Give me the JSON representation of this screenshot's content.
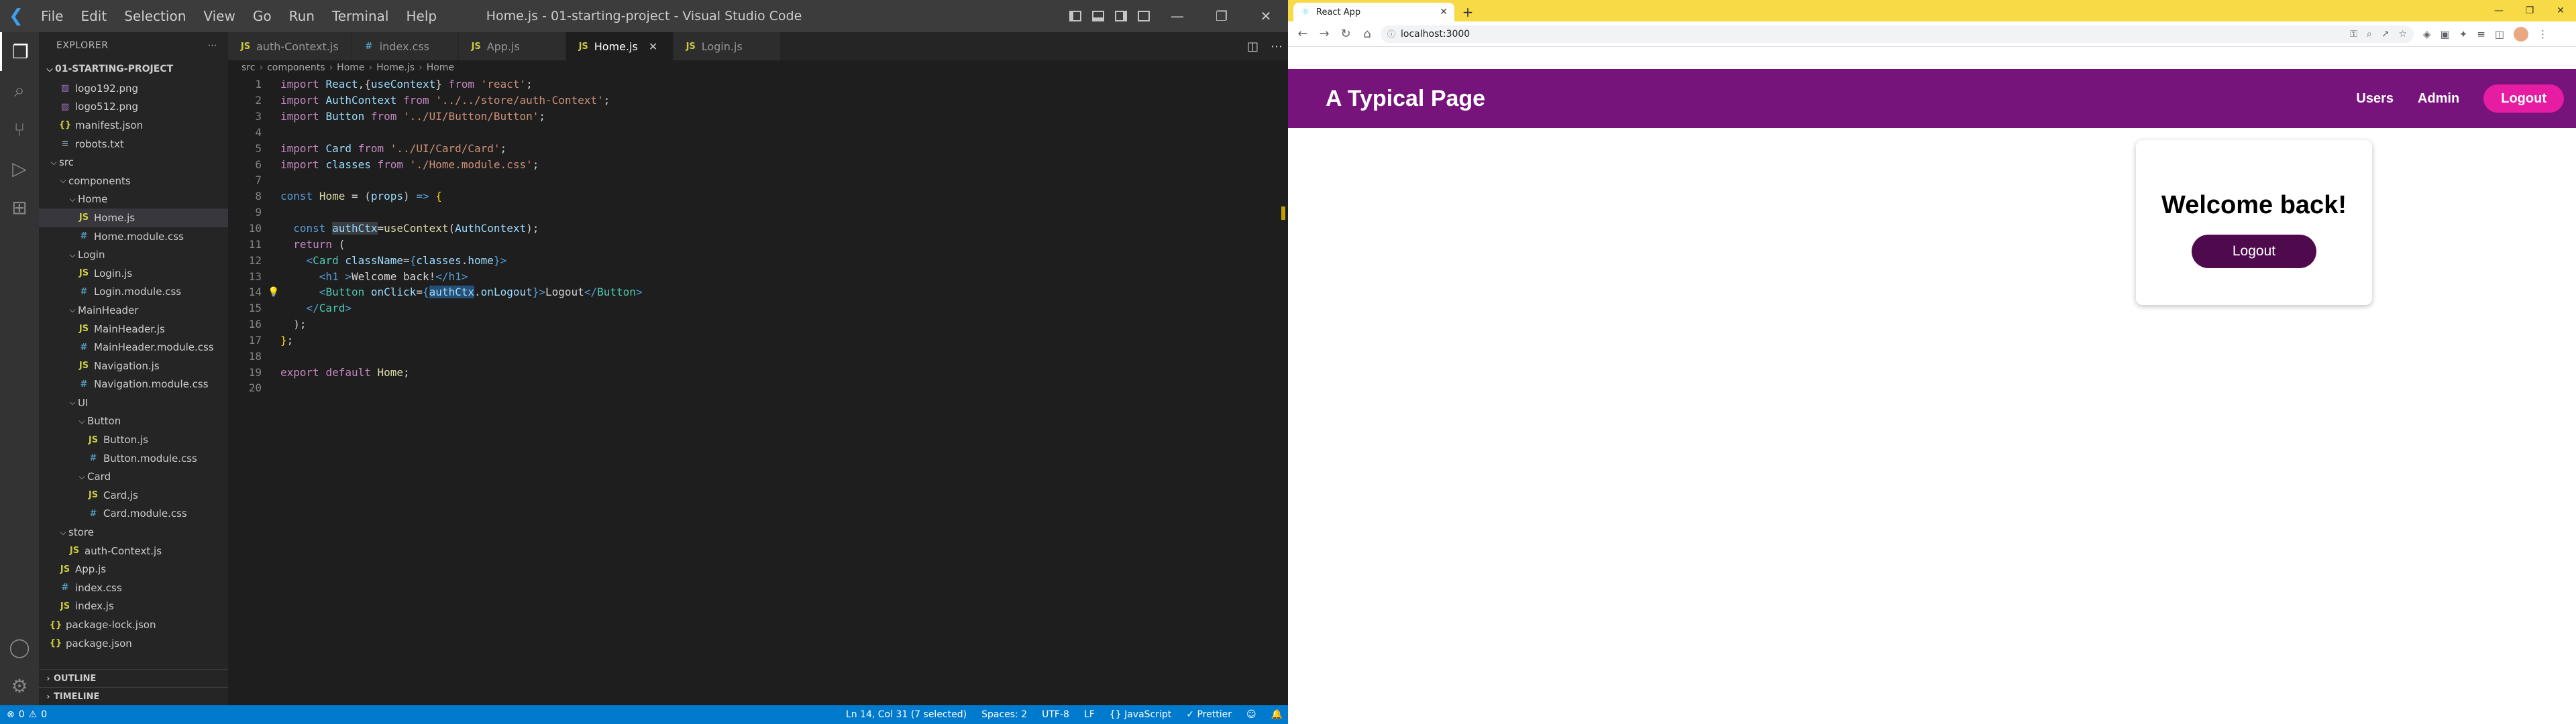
{
  "vscode": {
    "menu": [
      "File",
      "Edit",
      "Selection",
      "View",
      "Go",
      "Run",
      "Terminal",
      "Help"
    ],
    "window_title": "Home.js - 01-starting-project - Visual Studio Code",
    "explorer_title": "EXPLORER",
    "project": "01-STARTING-PROJECT",
    "tree": [
      {
        "label": "logo192.png",
        "indent": 1,
        "icon": "img"
      },
      {
        "label": "logo512.png",
        "indent": 1,
        "icon": "img"
      },
      {
        "label": "manifest.json",
        "indent": 1,
        "icon": "json"
      },
      {
        "label": "robots.txt",
        "indent": 1,
        "icon": "txt"
      },
      {
        "label": "src",
        "indent": 0,
        "folder": true
      },
      {
        "label": "components",
        "indent": 1,
        "folder": true
      },
      {
        "label": "Home",
        "indent": 2,
        "folder": true
      },
      {
        "label": "Home.js",
        "indent": 3,
        "icon": "js",
        "selected": true
      },
      {
        "label": "Home.module.css",
        "indent": 3,
        "icon": "css"
      },
      {
        "label": "Login",
        "indent": 2,
        "folder": true
      },
      {
        "label": "Login.js",
        "indent": 3,
        "icon": "js"
      },
      {
        "label": "Login.module.css",
        "indent": 3,
        "icon": "css"
      },
      {
        "label": "MainHeader",
        "indent": 2,
        "folder": true
      },
      {
        "label": "MainHeader.js",
        "indent": 3,
        "icon": "js"
      },
      {
        "label": "MainHeader.module.css",
        "indent": 3,
        "icon": "css"
      },
      {
        "label": "Navigation.js",
        "indent": 3,
        "icon": "js"
      },
      {
        "label": "Navigation.module.css",
        "indent": 3,
        "icon": "css"
      },
      {
        "label": "UI",
        "indent": 2,
        "folder": true
      },
      {
        "label": "Button",
        "indent": 3,
        "folder": true
      },
      {
        "label": "Button.js",
        "indent": 4,
        "icon": "js"
      },
      {
        "label": "Button.module.css",
        "indent": 4,
        "icon": "css"
      },
      {
        "label": "Card",
        "indent": 3,
        "folder": true
      },
      {
        "label": "Card.js",
        "indent": 4,
        "icon": "js"
      },
      {
        "label": "Card.module.css",
        "indent": 4,
        "icon": "css"
      },
      {
        "label": "store",
        "indent": 1,
        "folder": true
      },
      {
        "label": "auth-Context.js",
        "indent": 2,
        "icon": "js"
      },
      {
        "label": "App.js",
        "indent": 1,
        "icon": "js"
      },
      {
        "label": "index.css",
        "indent": 1,
        "icon": "css"
      },
      {
        "label": "index.js",
        "indent": 1,
        "icon": "js"
      },
      {
        "label": "package-lock.json",
        "indent": 0,
        "icon": "json"
      },
      {
        "label": "package.json",
        "indent": 0,
        "icon": "json"
      }
    ],
    "outline_label": "OUTLINE",
    "timeline_label": "TIMELINE",
    "tabs": [
      {
        "label": "auth-Context.js",
        "active": false
      },
      {
        "label": "index.css",
        "active": false,
        "css": true
      },
      {
        "label": "App.js",
        "active": false
      },
      {
        "label": "Home.js",
        "active": true
      },
      {
        "label": "Login.js",
        "active": false
      }
    ],
    "breadcrumb": [
      "src",
      "components",
      "Home",
      "Home.js",
      "Home"
    ],
    "status": {
      "errors": "0",
      "warnings": "0",
      "position": "Ln 14, Col 31 (7 selected)",
      "spaces": "Spaces: 2",
      "encoding": "UTF-8",
      "eol": "LF",
      "language": "JavaScript",
      "formatter": "Prettier"
    }
  },
  "browser": {
    "tab_title": "React App",
    "url": "localhost:3000",
    "page": {
      "title": "A Typical Page",
      "nav_users": "Users",
      "nav_admin": "Admin",
      "nav_logout": "Logout",
      "welcome": "Welcome back!",
      "card_logout": "Logout"
    },
    "colors": {
      "header_bg": "#77147b",
      "header_logout_bg": "#e61ca3",
      "card_logout_bg": "#4f0a4e",
      "tabstrip_bg": "#f8d946"
    }
  }
}
